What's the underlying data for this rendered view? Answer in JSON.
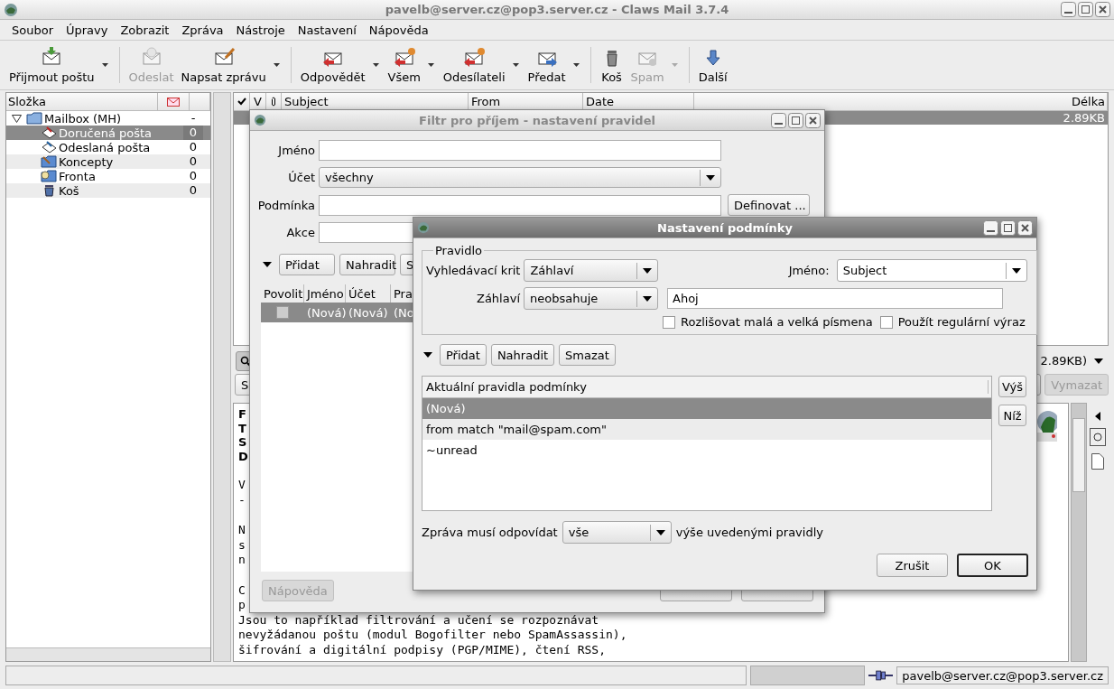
{
  "window": {
    "title": "pavelb@server.cz@pop3.server.cz - Claws Mail 3.7.4"
  },
  "menu": [
    "Soubor",
    "Úpravy",
    "Zobrazit",
    "Zpráva",
    "Nástroje",
    "Nastavení",
    "Nápověda"
  ],
  "toolbar": [
    {
      "items": [
        {
          "label": "Přijmout poštu",
          "disabled": false,
          "dropdown": true
        }
      ]
    },
    {
      "items": [
        {
          "label": "Odeslat",
          "disabled": true,
          "dropdown": false
        },
        {
          "label": "Napsat zprávu",
          "disabled": false,
          "dropdown": true
        }
      ]
    },
    {
      "items": [
        {
          "label": "Odpovědět",
          "disabled": false,
          "dropdown": true
        },
        {
          "label": "Všem",
          "disabled": false,
          "dropdown": true
        },
        {
          "label": "Odesílateli",
          "disabled": false,
          "dropdown": true
        },
        {
          "label": "Předat",
          "disabled": false,
          "dropdown": true
        }
      ]
    },
    {
      "items": [
        {
          "label": "Koš",
          "disabled": false,
          "dropdown": false
        },
        {
          "label": "Spam",
          "disabled": true,
          "dropdown": true
        }
      ]
    },
    {
      "items": [
        {
          "label": "Další",
          "disabled": false,
          "dropdown": false
        }
      ]
    }
  ],
  "folders": {
    "header": "Složka",
    "tree": [
      {
        "name": "Mailbox (MH)",
        "count": "-",
        "expanded": true,
        "selected": false,
        "children": [
          {
            "name": "Doručená pošta",
            "count": "0",
            "selected": true
          },
          {
            "name": "Odeslaná pošta",
            "count": "0",
            "selected": false
          },
          {
            "name": "Koncepty",
            "count": "0",
            "selected": false
          },
          {
            "name": "Fronta",
            "count": "0",
            "selected": false
          },
          {
            "name": "Koš",
            "count": "0",
            "selected": false
          }
        ]
      }
    ]
  },
  "message_list": {
    "columns": [
      "V",
      "Subject",
      "From",
      "Date",
      "Délka"
    ],
    "rows": [
      {
        "size": "2.89KB",
        "selected": true
      }
    ]
  },
  "summary": "2.89KB)",
  "quick_search": {
    "type_button": "S",
    "clear_button": {
      "label": "Vymazat",
      "disabled": true
    }
  },
  "message_view": {
    "headers": [
      "F",
      "T",
      "S",
      "D"
    ],
    "paragraphs": [
      [
        "V",
        "-"
      ],
      [
        "N",
        "s",
        "n"
      ],
      [
        "C",
        "p",
        "Jsou to například filtrování a učení se rozpoznávat",
        "nevyžádanou poštu (modul Bogofilter nebo SpamAssassin),",
        "šifrování a digitální podpisy (PGP/MIME), čtení RSS,"
      ]
    ]
  },
  "status_bar": {
    "account": "pavelb@server.cz@pop3.server.cz"
  },
  "filter_dialog": {
    "title": "Filtr pro příjem - nastavení pravidel",
    "fields": [
      {
        "label": "Jméno",
        "kind": "entry"
      },
      {
        "label": "Účet",
        "kind": "combo",
        "value": "všechny"
      },
      {
        "label": "Podmínka",
        "kind": "entry",
        "button": "Definovat ..."
      },
      {
        "label": "Akce",
        "kind": "entry"
      }
    ],
    "buttons": [
      "Přidat",
      "Nahradit",
      "S"
    ],
    "columns": [
      "Povolit",
      "Jméno",
      "Účet",
      "Pra"
    ],
    "rows": [
      {
        "enabled": false,
        "selected": true,
        "name": "(Nová)",
        "account": "(Nová)",
        "rule": "(No"
      }
    ],
    "help_button": {
      "label": "Nápověda",
      "disabled": true
    }
  },
  "condition_dialog": {
    "title": "Nastavení podmínky",
    "group": "Pravidlo",
    "criteria_label": "Vyhledávací krit",
    "criteria": "Záhlaví",
    "name_label": "Jméno:",
    "name": "Subject",
    "header_label": "Záhlaví",
    "match": "neobsahuje",
    "value": "Ahoj",
    "options": [
      {
        "label": "Rozlišovat malá a velká písmena",
        "checked": false
      },
      {
        "label": "Použít regulární výraz",
        "checked": false
      }
    ],
    "buttons": [
      "Přidat",
      "Nahradit",
      "Smazat"
    ],
    "list_header": "Aktuální pravidla podmínky",
    "rules": [
      {
        "text": "(Nová)",
        "selected": true
      },
      {
        "text": "from match \"mail@spam.com\"",
        "selected": false
      },
      {
        "text": "~unread",
        "selected": false
      }
    ],
    "side_buttons": [
      "Výš",
      "Níž"
    ],
    "match_label": "Zpráva musí odpovídat",
    "match_mode": "vše",
    "match_suffix": "výše uvedenými pravidly",
    "actions": [
      {
        "label": "Zrušit",
        "default": false
      },
      {
        "label": "OK",
        "default": true
      }
    ]
  }
}
